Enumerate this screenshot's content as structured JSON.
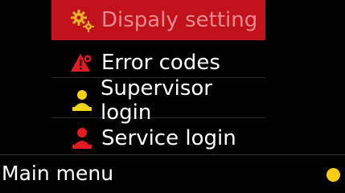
{
  "menu": {
    "items": [
      {
        "label": "Dispaly setting",
        "icon": "gear-icon",
        "selected": true
      },
      {
        "label": "Error codes",
        "icon": "error-warning-icon",
        "selected": false
      },
      {
        "label": "Supervisor login",
        "icon": "supervisor-user-icon",
        "selected": false
      },
      {
        "label": "Service login",
        "icon": "service-user-icon",
        "selected": false
      }
    ]
  },
  "footer": {
    "label": "Main menu",
    "status_indicator": "status-dot"
  },
  "colors": {
    "selected_bg": "#c1121b",
    "selected_text": "#e8898d",
    "warning": "#e31b23",
    "supervisor": "#f2d216",
    "service": "#e31b23",
    "status": "#ffcc12"
  }
}
